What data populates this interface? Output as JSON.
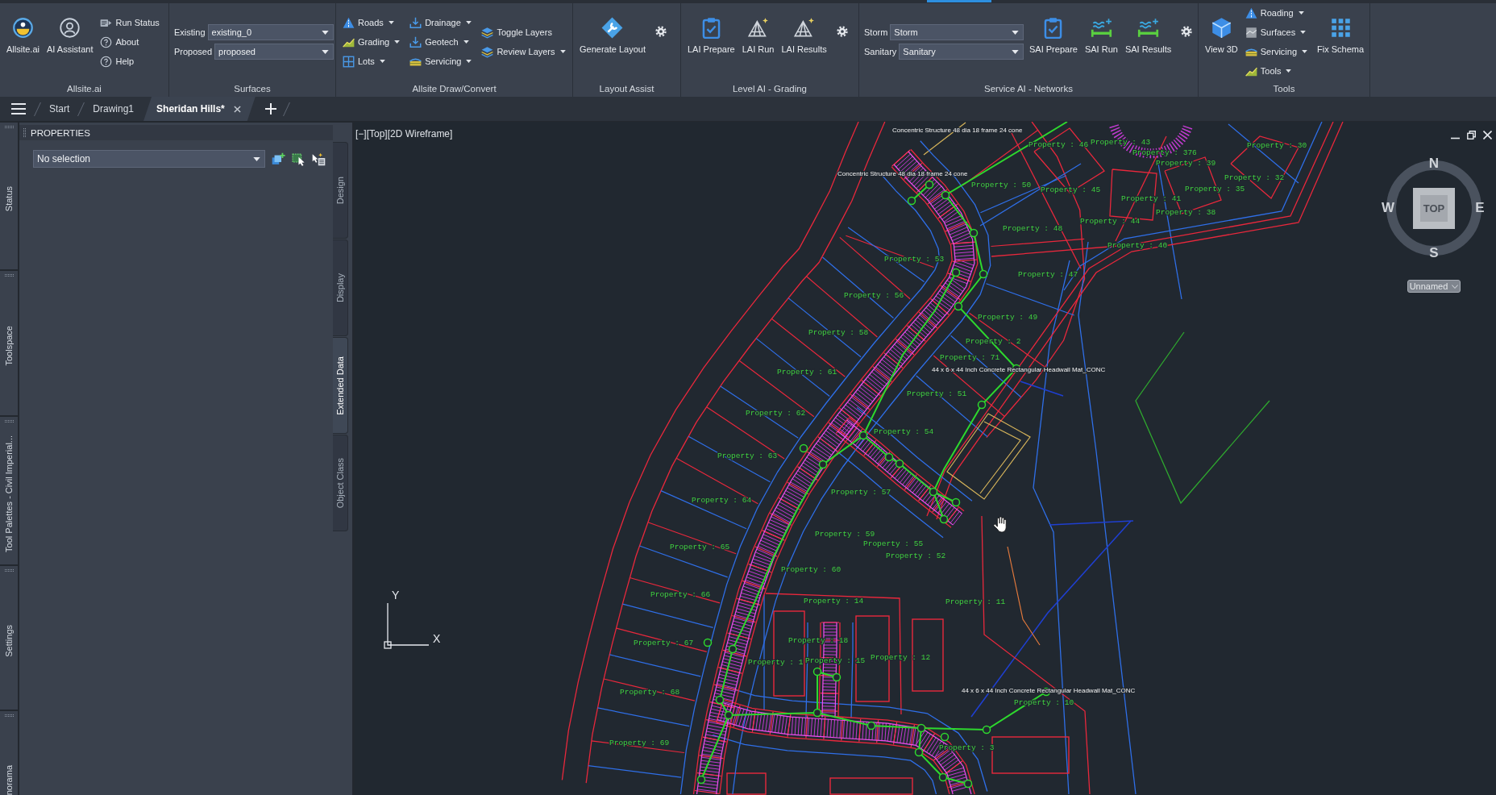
{
  "ribbon": {
    "panels": [
      {
        "title": "Allsite.ai",
        "sections": [
          {
            "kind": "large",
            "label": "Allsite.ai"
          },
          {
            "kind": "large",
            "label": "AI Assistant"
          },
          {
            "kind": "small_list",
            "items": [
              {
                "label": "Run Status",
                "has_menu": false
              },
              {
                "label": "About",
                "has_menu": false
              },
              {
                "label": "Help",
                "has_menu": false
              }
            ]
          }
        ]
      },
      {
        "title": "Surfaces",
        "sections": [
          {
            "kind": "fields",
            "fields": [
              {
                "label": "Existing",
                "value": "existing_0"
              },
              {
                "label": "Proposed",
                "value": "proposed"
              }
            ]
          }
        ]
      },
      {
        "title": "Allsite Draw/Convert",
        "sections": [
          {
            "kind": "small_list",
            "items": [
              {
                "label": "Roads",
                "has_menu": true
              },
              {
                "label": "Grading",
                "has_menu": true
              },
              {
                "label": "Lots",
                "has_menu": true
              }
            ]
          },
          {
            "kind": "small_list",
            "items": [
              {
                "label": "Drainage",
                "has_menu": true
              },
              {
                "label": "Geotech",
                "has_menu": true
              },
              {
                "label": "Servicing",
                "has_menu": true
              }
            ]
          },
          {
            "kind": "small_list",
            "items": [
              {
                "label": "Toggle Layers",
                "has_menu": false
              },
              {
                "label": "Review Layers",
                "has_menu": true
              }
            ]
          }
        ]
      },
      {
        "title": "Layout Assist",
        "sections": [
          {
            "kind": "large",
            "label": "Generate Layout"
          },
          {
            "kind": "settings"
          }
        ]
      },
      {
        "title": "Level AI - Grading",
        "sections": [
          {
            "kind": "large",
            "label": "LAI Prepare"
          },
          {
            "kind": "large",
            "label": "LAI Run"
          },
          {
            "kind": "large",
            "label": "LAI Results"
          },
          {
            "kind": "settings"
          }
        ]
      },
      {
        "title": "Service AI - Networks",
        "sections": [
          {
            "kind": "fields",
            "fields": [
              {
                "label": "Storm",
                "value": "Storm"
              },
              {
                "label": "Sanitary",
                "value": "Sanitary"
              }
            ]
          },
          {
            "kind": "large",
            "label": "SAI Prepare"
          },
          {
            "kind": "large",
            "label": "SAI Run"
          },
          {
            "kind": "large",
            "label": "SAI Results"
          },
          {
            "kind": "settings"
          }
        ]
      },
      {
        "title": "Tools",
        "sections": [
          {
            "kind": "large",
            "label": "View 3D"
          },
          {
            "kind": "small_list",
            "items": [
              {
                "label": "Roading",
                "has_menu": true
              },
              {
                "label": "Surfaces",
                "has_menu": true
              },
              {
                "label": "Servicing",
                "has_menu": true
              },
              {
                "label": "Tools",
                "has_menu": true
              }
            ]
          },
          {
            "kind": "large",
            "label": "Fix Schema"
          }
        ]
      }
    ]
  },
  "file_tabs": [
    {
      "label": "Start",
      "selected": false
    },
    {
      "label": "Drawing1",
      "selected": false
    },
    {
      "label": "Sheridan Hills*",
      "selected": true
    }
  ],
  "side_palettes": [
    "Status",
    "Toolspace",
    "Tool Palettes - Civil Imperial...",
    "Settings",
    "norama"
  ],
  "properties": {
    "title": "PROPERTIES",
    "selection": "No selection",
    "tabs": [
      {
        "label": "Design",
        "selected": false
      },
      {
        "label": "Display",
        "selected": false
      },
      {
        "label": "Extended Data",
        "selected": true
      },
      {
        "label": "Object Class",
        "selected": false
      }
    ]
  },
  "viewport": {
    "controls": [
      "[−]",
      "[Top]",
      "[2D Wireframe]"
    ],
    "view_cube": {
      "north": "N",
      "west": "W",
      "face": "TOP",
      "east": "E",
      "south": "S"
    },
    "ucs_menu": "Unnamed",
    "ucs_axes": {
      "y": "Y",
      "x": "X"
    },
    "labels": [
      {
        "kind": "structure",
        "text": "Concentric Structure 48 dia 18 frame 24 cone"
      },
      {
        "kind": "property",
        "text": "Property : 46"
      },
      {
        "kind": "property",
        "text": "Property : 43"
      },
      {
        "kind": "property",
        "text": "Property : 30"
      },
      {
        "kind": "property",
        "text": "Property : 376"
      },
      {
        "kind": "property",
        "text": "Property : 39"
      },
      {
        "kind": "structure",
        "text": "Concentric Structure 48 dia 18 frame 24 cone"
      },
      {
        "kind": "property",
        "text": "Property : 32"
      },
      {
        "kind": "property",
        "text": "Property : 50"
      },
      {
        "kind": "property",
        "text": "Property : 45"
      },
      {
        "kind": "property",
        "text": "Property : 35"
      },
      {
        "kind": "property",
        "text": "Property : 41"
      },
      {
        "kind": "property",
        "text": "Property : 38"
      },
      {
        "kind": "property",
        "text": "Property : 44"
      },
      {
        "kind": "property",
        "text": "Property : 48"
      },
      {
        "kind": "property",
        "text": "Property : 40"
      },
      {
        "kind": "property",
        "text": "Property : 53"
      },
      {
        "kind": "property",
        "text": "Property : 47"
      },
      {
        "kind": "property",
        "text": "Property : 56"
      },
      {
        "kind": "property",
        "text": "Property : 49"
      },
      {
        "kind": "property",
        "text": "Property : 58"
      },
      {
        "kind": "property",
        "text": "Property : 2"
      },
      {
        "kind": "property",
        "text": "Property : 71"
      },
      {
        "kind": "property",
        "text": "Property : 61"
      },
      {
        "kind": "structure",
        "text": "44 x 6 x 44 Inch Concrete Rectangular Headwall Mat_CONC"
      },
      {
        "kind": "property",
        "text": "Property : 51"
      },
      {
        "kind": "property",
        "text": "Property : 62"
      },
      {
        "kind": "property",
        "text": "Property : 54"
      },
      {
        "kind": "property",
        "text": "Property : 63"
      },
      {
        "kind": "property",
        "text": "Property : 57"
      },
      {
        "kind": "property",
        "text": "Property : 64"
      },
      {
        "kind": "property",
        "text": "Property : 59"
      },
      {
        "kind": "property",
        "text": "Property : 65"
      },
      {
        "kind": "property",
        "text": "Property : 55"
      },
      {
        "kind": "property",
        "text": "Property : 52"
      },
      {
        "kind": "property",
        "text": "Property : 60"
      },
      {
        "kind": "property",
        "text": "Property : 66"
      },
      {
        "kind": "property",
        "text": "Property : 14"
      },
      {
        "kind": "property",
        "text": "Property : 11"
      },
      {
        "kind": "property",
        "text": "Property : 67"
      },
      {
        "kind": "property",
        "text": "Property : 18"
      },
      {
        "kind": "property",
        "text": "Property : 1"
      },
      {
        "kind": "property",
        "text": "Property : 15"
      },
      {
        "kind": "property",
        "text": "Property : 12"
      },
      {
        "kind": "property",
        "text": "Property : 68"
      },
      {
        "kind": "structure",
        "text": "44 x 6 x 44 Inch Concrete Rectangular Headwall Mat_CONC"
      },
      {
        "kind": "property",
        "text": "Property : 10"
      },
      {
        "kind": "property",
        "text": "Property : 69"
      },
      {
        "kind": "property",
        "text": "Property : 3"
      }
    ]
  }
}
